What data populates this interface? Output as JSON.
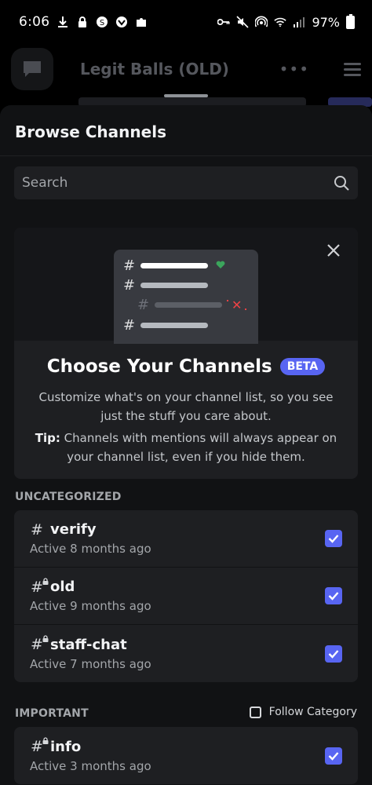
{
  "status_bar": {
    "time": "6:06",
    "battery": "97%"
  },
  "background": {
    "server_title": "Legit Balls (OLD)",
    "more_icon": "more-horizontal-icon",
    "menu_icon": "hamburger-menu-icon"
  },
  "sheet": {
    "title": "Browse Channels",
    "search_placeholder": "Search"
  },
  "promo": {
    "title": "Choose Your Channels",
    "badge": "BETA",
    "description": "Customize what's on your channel list, so you see just the stuff you care about.",
    "tip_label": "Tip:",
    "tip_text": " Channels with mentions will always appear on your channel list, even if you hide them."
  },
  "categories": [
    {
      "name": "UNCATEGORIZED",
      "channels": [
        {
          "name": "verify",
          "activity": "Active 8 months ago",
          "locked": false,
          "checked": true
        },
        {
          "name": "old",
          "activity": "Active 9 months ago",
          "locked": true,
          "checked": true
        },
        {
          "name": "staff-chat",
          "activity": "Active 7 months ago",
          "locked": true,
          "checked": true
        }
      ]
    },
    {
      "name": "IMPORTANT",
      "follow_label": "Follow Category",
      "follow_checked": false,
      "channels": [
        {
          "name": "info",
          "activity": "Active 3 months ago",
          "locked": true,
          "checked": true
        }
      ]
    }
  ],
  "colors": {
    "accent": "#5865f2",
    "sheet_bg": "#111214",
    "card_bg": "#1e1f22",
    "heart": "#3ba55c",
    "remove": "#ed4245"
  }
}
